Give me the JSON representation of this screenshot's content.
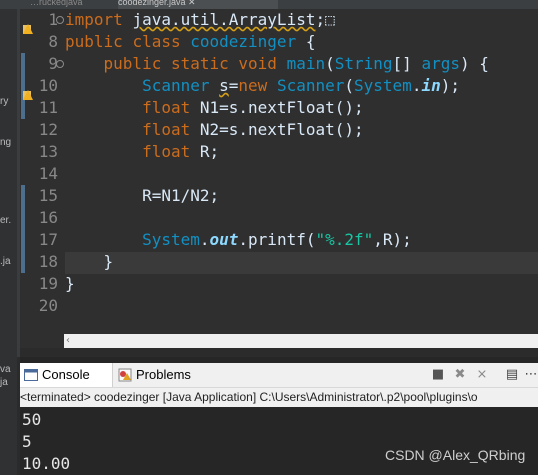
{
  "tabs": [
    {
      "label": "…ruckedjava"
    },
    {
      "label": "coodezinger.java ✕"
    }
  ],
  "left_panel_fragments": [
    "ry",
    "ng",
    "er.",
    ".ja",
    "va",
    "ja"
  ],
  "editor": {
    "line_numbers": [
      "1",
      "8",
      "9",
      "10",
      "11",
      "12",
      "13",
      "14",
      "15",
      "16",
      "17",
      "18",
      "19",
      "20"
    ],
    "lines": [
      [
        {
          "t": "import ",
          "c": "kw"
        },
        {
          "t": "java.util.ArrayList",
          "c": "pl sqg"
        },
        {
          "t": ";",
          "c": "pl"
        },
        {
          "t": "⬚",
          "c": "pl"
        }
      ],
      [
        {
          "t": "public ",
          "c": "kw"
        },
        {
          "t": "class ",
          "c": "kw"
        },
        {
          "t": "coodezinger ",
          "c": "ty"
        },
        {
          "t": "{",
          "c": "pl"
        }
      ],
      [
        {
          "t": "    public ",
          "c": "kw"
        },
        {
          "t": "static ",
          "c": "kw"
        },
        {
          "t": "void ",
          "c": "kw"
        },
        {
          "t": "main",
          "c": "ty"
        },
        {
          "t": "(",
          "c": "pl"
        },
        {
          "t": "String",
          "c": "ty"
        },
        {
          "t": "[] ",
          "c": "pl"
        },
        {
          "t": "args",
          "c": "ty"
        },
        {
          "t": ") ",
          "c": "pl"
        },
        {
          "t": "{",
          "c": "pl"
        }
      ],
      [
        {
          "t": "        Scanner ",
          "c": "ty"
        },
        {
          "t": "s",
          "c": "pl sqg"
        },
        {
          "t": "=",
          "c": "pl"
        },
        {
          "t": "new ",
          "c": "kw"
        },
        {
          "t": "Scanner",
          "c": "ty"
        },
        {
          "t": "(",
          "c": "pl"
        },
        {
          "t": "System",
          "c": "ty"
        },
        {
          "t": ".",
          "c": "pl"
        },
        {
          "t": "in",
          "c": "fld"
        },
        {
          "t": ");",
          "c": "pl"
        }
      ],
      [
        {
          "t": "        float ",
          "c": "kw"
        },
        {
          "t": "N1",
          "c": "pl"
        },
        {
          "t": "=s.nextFloat();",
          "c": "pl"
        }
      ],
      [
        {
          "t": "        float ",
          "c": "kw"
        },
        {
          "t": "N2",
          "c": "pl"
        },
        {
          "t": "=s.nextFloat();",
          "c": "pl"
        }
      ],
      [
        {
          "t": "        float ",
          "c": "kw"
        },
        {
          "t": "R;",
          "c": "pl"
        }
      ],
      [
        {
          "t": "",
          "c": "pl"
        }
      ],
      [
        {
          "t": "        R=N1/N2;",
          "c": "pl"
        }
      ],
      [
        {
          "t": "",
          "c": "pl"
        }
      ],
      [
        {
          "t": "        System",
          "c": "ty"
        },
        {
          "t": ".",
          "c": "pl"
        },
        {
          "t": "out",
          "c": "fld"
        },
        {
          "t": ".printf(",
          "c": "pl"
        },
        {
          "t": "\"%.2f\"",
          "c": "str"
        },
        {
          "t": ",R);",
          "c": "pl"
        }
      ],
      [
        {
          "t": "    }",
          "c": "pl"
        }
      ],
      [
        {
          "t": "}",
          "c": "pl"
        }
      ],
      [
        {
          "t": "",
          "c": "pl"
        }
      ]
    ]
  },
  "console": {
    "tab_console": "Console",
    "tab_problems": "Problems",
    "toolbar_icons": [
      "terminate-icon",
      "remove-launch-icon",
      "remove-all-icon",
      "pin-console-icon"
    ],
    "status": "<terminated> coodezinger [Java Application] C:\\Users\\Administrator\\.p2\\pool\\plugins\\o",
    "output": [
      "50",
      "5",
      "10.00"
    ]
  },
  "watermark": "CSDN @Alex_QRbing",
  "colors": {
    "keyword": "#cc6c1d",
    "type": "#1290c3",
    "field": "#8dd9ff",
    "string": "#17c6a3",
    "plain": "#d9e8f7",
    "background": "#2f2f2f"
  }
}
